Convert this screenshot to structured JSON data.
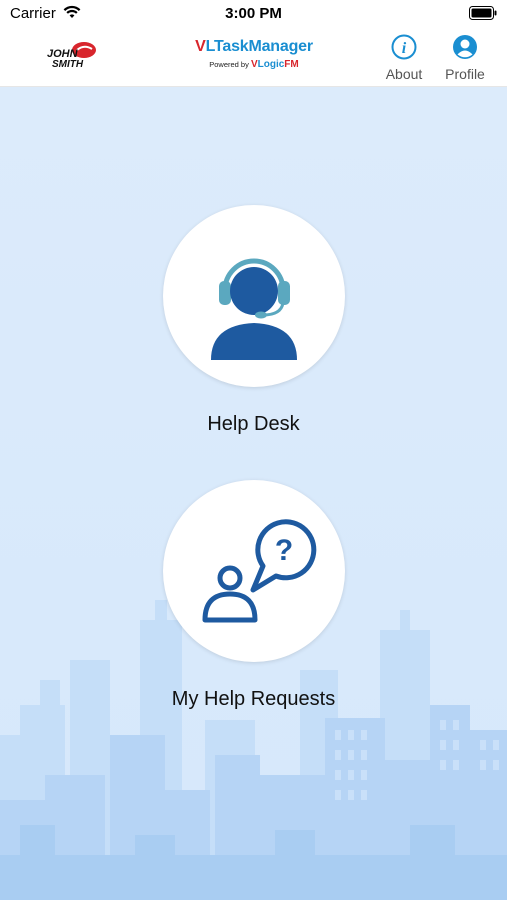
{
  "status": {
    "carrier": "Carrier",
    "time": "3:00 PM"
  },
  "header": {
    "logo_line1": "JOHN",
    "logo_line2": "SMITH",
    "brand_v": "V",
    "brand_rest": "LTaskManager",
    "powered_by": "Powered by",
    "powered_v": "V",
    "powered_logic": "Logic",
    "powered_fm": "FM",
    "about_label": "About",
    "profile_label": "Profile"
  },
  "menu": {
    "help_desk": "Help Desk",
    "my_help_requests": "My Help Requests"
  },
  "colors": {
    "brand_red": "#d8262d",
    "brand_blue": "#1a8ed1",
    "icon_blue": "#1e5aa0",
    "background": "#dcebfb"
  }
}
